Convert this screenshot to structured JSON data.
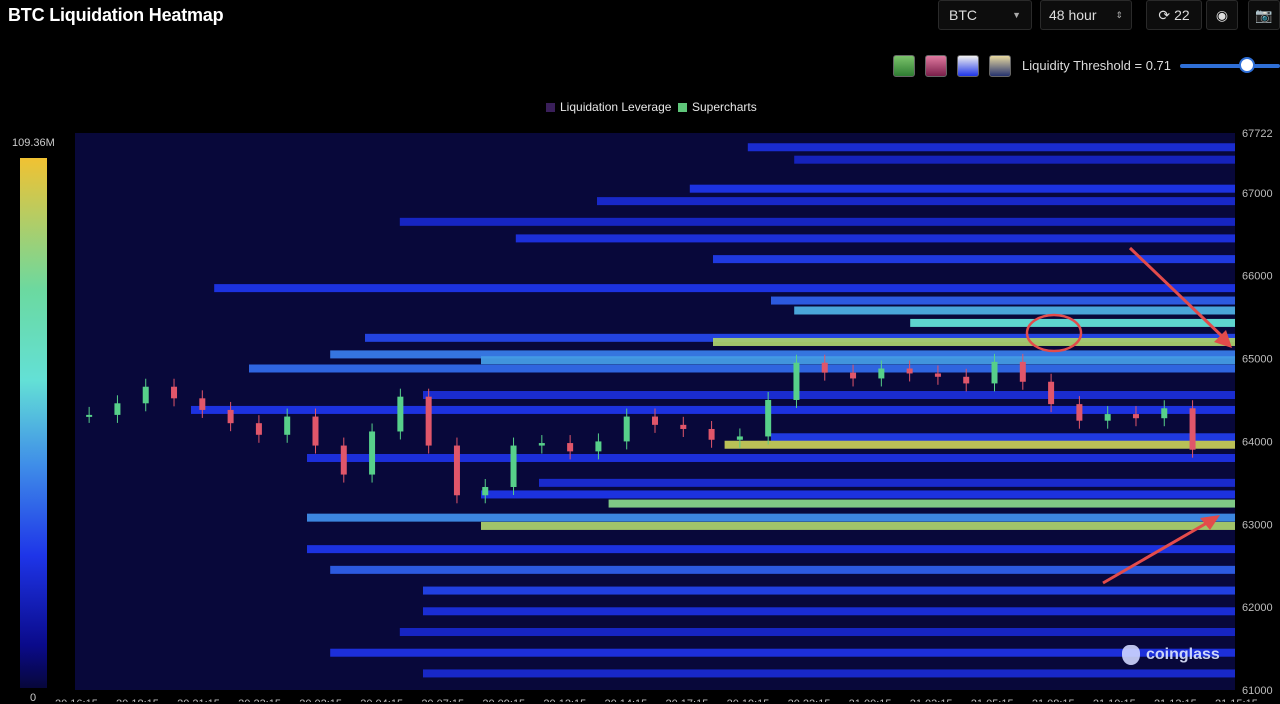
{
  "title": "BTC Liquidation Heatmap",
  "controls": {
    "symbol": "BTC",
    "range": "48 hour",
    "refresh_count": "22"
  },
  "color_schemes": [
    {
      "name": "green-scheme",
      "gradient": [
        "#2e7d32",
        "#7cc36b"
      ]
    },
    {
      "name": "pink-scheme",
      "gradient": [
        "#7a1f4a",
        "#e07aa0"
      ]
    },
    {
      "name": "blue-scheme",
      "gradient": [
        "#1e35e8",
        "#f1f1f1"
      ]
    },
    {
      "name": "gold-scheme",
      "gradient": [
        "#26336e",
        "#e8d9a0"
      ]
    }
  ],
  "threshold": {
    "label": "Liquidity Threshold = 0.71",
    "value": 0.71
  },
  "colors": {
    "leverage": "#3a1f5a",
    "supercharts": "#5fc67a",
    "background": "#000000",
    "heat_low": "#0a0a8a",
    "heat_high": "#f1c232",
    "up": "#57d08a",
    "down": "#e0566a"
  },
  "scale": {
    "max": "109.36M",
    "min": "0"
  },
  "watermark": "coinglass",
  "chart_data": {
    "type": "heatmap",
    "legend": [
      "Liquidation Leverage",
      "Supercharts"
    ],
    "ylim": [
      61000,
      67722
    ],
    "y_ticks": [
      "67722",
      "67000",
      "66000",
      "65000",
      "64000",
      "63000",
      "62000",
      "61000"
    ],
    "x_ticks": [
      "20 16:15",
      "20 18:15",
      "20 21:15",
      "20 23:15",
      "20 02:15",
      "20 04:15",
      "20 07:15",
      "20 09:15",
      "20 12:15",
      "20 14:15",
      "20 17:15",
      "20 19:15",
      "20 22:15",
      "21 00:15",
      "21 03:15",
      "21 05:15",
      "21 08:15",
      "21 10:15",
      "21 13:15",
      "21 15:15"
    ],
    "price_series": [
      {
        "t": 0,
        "p": 64320
      },
      {
        "t": 1,
        "p": 64460
      },
      {
        "t": 2,
        "p": 64660
      },
      {
        "t": 3,
        "p": 64520
      },
      {
        "t": 4,
        "p": 64380
      },
      {
        "t": 5,
        "p": 64220
      },
      {
        "t": 6,
        "p": 64080
      },
      {
        "t": 7,
        "p": 64300
      },
      {
        "t": 8,
        "p": 63950
      },
      {
        "t": 9,
        "p": 63600
      },
      {
        "t": 10,
        "p": 64120
      },
      {
        "t": 11,
        "p": 64540
      },
      {
        "t": 12,
        "p": 63950
      },
      {
        "t": 13,
        "p": 63350
      },
      {
        "t": 14,
        "p": 63450
      },
      {
        "t": 15,
        "p": 63950
      },
      {
        "t": 16,
        "p": 63980
      },
      {
        "t": 17,
        "p": 63880
      },
      {
        "t": 18,
        "p": 64000
      },
      {
        "t": 19,
        "p": 64300
      },
      {
        "t": 20,
        "p": 64200
      },
      {
        "t": 21,
        "p": 64150
      },
      {
        "t": 22,
        "p": 64020
      },
      {
        "t": 23,
        "p": 64060
      },
      {
        "t": 24,
        "p": 64500
      },
      {
        "t": 25,
        "p": 64950
      },
      {
        "t": 26,
        "p": 64830
      },
      {
        "t": 27,
        "p": 64760
      },
      {
        "t": 28,
        "p": 64880
      },
      {
        "t": 29,
        "p": 64820
      },
      {
        "t": 30,
        "p": 64780
      },
      {
        "t": 31,
        "p": 64700
      },
      {
        "t": 32,
        "p": 64960
      },
      {
        "t": 33,
        "p": 64720
      },
      {
        "t": 34,
        "p": 64450
      },
      {
        "t": 35,
        "p": 64250
      },
      {
        "t": 36,
        "p": 64330
      },
      {
        "t": 37,
        "p": 64280
      },
      {
        "t": 38,
        "p": 64400
      },
      {
        "t": 39,
        "p": 63900
      }
    ],
    "liquidity_bands": [
      {
        "price": 67550,
        "start": 0.58,
        "level": 0.25
      },
      {
        "price": 67400,
        "start": 0.62,
        "level": 0.18
      },
      {
        "price": 67050,
        "start": 0.53,
        "level": 0.3
      },
      {
        "price": 66900,
        "start": 0.45,
        "level": 0.22
      },
      {
        "price": 66650,
        "start": 0.28,
        "level": 0.2
      },
      {
        "price": 66450,
        "start": 0.38,
        "level": 0.28
      },
      {
        "price": 66200,
        "start": 0.55,
        "level": 0.32
      },
      {
        "price": 65850,
        "start": 0.12,
        "level": 0.3
      },
      {
        "price": 65700,
        "start": 0.6,
        "level": 0.42
      },
      {
        "price": 65580,
        "start": 0.62,
        "level": 0.62
      },
      {
        "price": 65430,
        "start": 0.72,
        "level": 0.72
      },
      {
        "price": 65250,
        "start": 0.25,
        "level": 0.35
      },
      {
        "price": 65200,
        "start": 0.55,
        "level": 0.92
      },
      {
        "price": 65050,
        "start": 0.22,
        "level": 0.5
      },
      {
        "price": 64980,
        "start": 0.35,
        "level": 0.58
      },
      {
        "price": 64880,
        "start": 0.15,
        "level": 0.45
      },
      {
        "price": 64560,
        "start": 0.3,
        "level": 0.25
      },
      {
        "price": 64380,
        "start": 0.1,
        "level": 0.3
      },
      {
        "price": 64050,
        "start": 0.6,
        "level": 0.32
      },
      {
        "price": 63960,
        "start": 0.56,
        "level": 0.95
      },
      {
        "price": 63800,
        "start": 0.2,
        "level": 0.28
      },
      {
        "price": 63500,
        "start": 0.4,
        "level": 0.24
      },
      {
        "price": 63360,
        "start": 0.35,
        "level": 0.3
      },
      {
        "price": 63250,
        "start": 0.46,
        "level": 0.88
      },
      {
        "price": 63080,
        "start": 0.2,
        "level": 0.55
      },
      {
        "price": 62980,
        "start": 0.35,
        "level": 0.92
      },
      {
        "price": 62700,
        "start": 0.2,
        "level": 0.3
      },
      {
        "price": 62450,
        "start": 0.22,
        "level": 0.42
      },
      {
        "price": 62200,
        "start": 0.3,
        "level": 0.34
      },
      {
        "price": 61950,
        "start": 0.3,
        "level": 0.26
      },
      {
        "price": 61700,
        "start": 0.28,
        "level": 0.2
      },
      {
        "price": 61450,
        "start": 0.22,
        "level": 0.28
      },
      {
        "price": 61200,
        "start": 0.3,
        "level": 0.22
      }
    ]
  }
}
